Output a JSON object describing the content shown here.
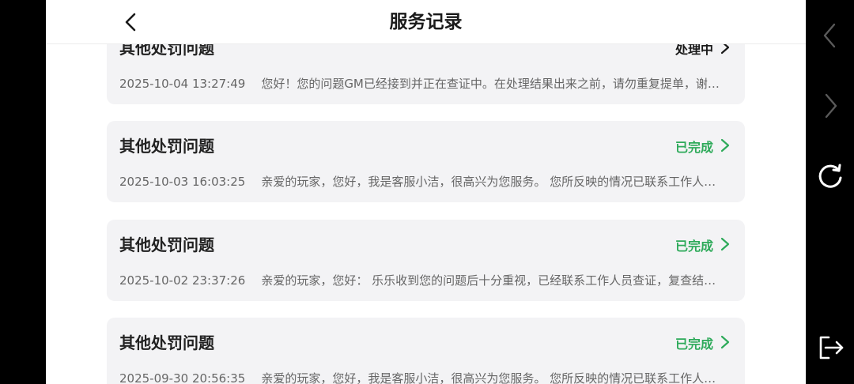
{
  "header": {
    "title": "服务记录"
  },
  "records": [
    {
      "title": "其他处罚问题",
      "status": "处理中",
      "status_kind": "pending",
      "date": "2025-10-04 13:27:49",
      "summary": "您好！您的问题GM已经接到并正在查证中。在处理结果出来之前，请勿重复提单，谢…"
    },
    {
      "title": "其他处罚问题",
      "status": "已完成",
      "status_kind": "done",
      "date": "2025-10-03 16:03:25",
      "summary": "亲爱的玩家，您好，我是客服小洁，很高兴为您服务。 您所反映的情况已联系工作人…"
    },
    {
      "title": "其他处罚问题",
      "status": "已完成",
      "status_kind": "done",
      "date": "2025-10-02 23:37:26",
      "summary": "亲爱的玩家，您好： 乐乐收到您的问题后十分重视，已经联系工作人员查证，复查结…"
    },
    {
      "title": "其他处罚问题",
      "status": "已完成",
      "status_kind": "done",
      "date": "2025-09-30 20:56:35",
      "summary": "亲爱的玩家，您好，我是客服小洁，很高兴为您服务。 您所反映的情况已联系工作人…"
    }
  ],
  "colors": {
    "done": "#2eaa5a",
    "pending": "#1a1a1a",
    "card_bg": "#f3f3f5"
  },
  "side_nav": [
    "chevron-left-icon",
    "chevron-right-icon",
    "refresh-icon",
    "exit-icon"
  ]
}
